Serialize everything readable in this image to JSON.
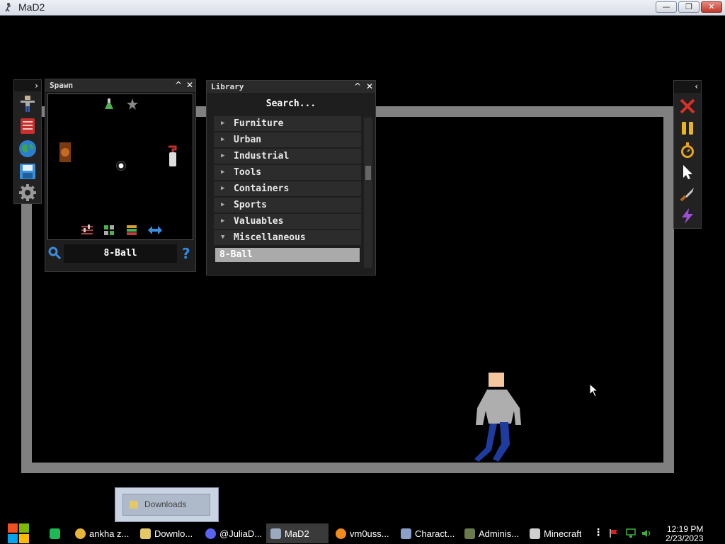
{
  "window": {
    "title": "MaD2",
    "minimize": "—",
    "maximize": "❐",
    "close": "✕"
  },
  "left_toolbar": {
    "expand": "›",
    "tools": [
      "ragdoll-icon",
      "book-icon",
      "globe-icon",
      "save-icon",
      "settings-icon"
    ]
  },
  "spawn_panel": {
    "title": "Spawn",
    "collapse": "^",
    "close": "✕",
    "selected": "8-Ball",
    "help": "?"
  },
  "library_panel": {
    "title": "Library",
    "collapse": "^",
    "close": "✕",
    "search_placeholder": "Search...",
    "categories": [
      {
        "label": "Furniture",
        "arrow": "▶"
      },
      {
        "label": "Urban",
        "arrow": "▶"
      },
      {
        "label": "Industrial",
        "arrow": "▶"
      },
      {
        "label": "Tools",
        "arrow": "▶"
      },
      {
        "label": "Containers",
        "arrow": "▶"
      },
      {
        "label": "Sports",
        "arrow": "▶"
      },
      {
        "label": "Valuables",
        "arrow": "▶"
      },
      {
        "label": "Miscellaneous",
        "arrow": "▼"
      }
    ],
    "selected_item": "8-Ball"
  },
  "right_toolbar": {
    "collapse": "‹",
    "tools": [
      "close-x-icon",
      "pause-icon",
      "stopwatch-icon",
      "cursor-icon",
      "knife-icon",
      "lightning-icon"
    ]
  },
  "downloads_popup": {
    "label": "Downloads"
  },
  "taskbar": {
    "items": [
      {
        "label": "",
        "icon_color": "#1db954"
      },
      {
        "label": "ankha z...",
        "icon_color": "#e9b43a"
      },
      {
        "label": "Downlo...",
        "icon_color": "#e3c865"
      },
      {
        "label": "@JuliaD...",
        "icon_color": "#5865f2"
      },
      {
        "label": "MaD2",
        "icon_color": "#9aa8c0"
      },
      {
        "label": "vm0uss...",
        "icon_color": "#f08a1c"
      },
      {
        "label": "Charact...",
        "icon_color": "#8aa0c8"
      },
      {
        "label": "Adminis...",
        "icon_color": "#6a7a4a"
      },
      {
        "label": "Minecraft",
        "icon_color": "#d0d0d0"
      }
    ],
    "tray_more": "⋮",
    "time": "12:19 PM",
    "date": "2/23/2023"
  }
}
